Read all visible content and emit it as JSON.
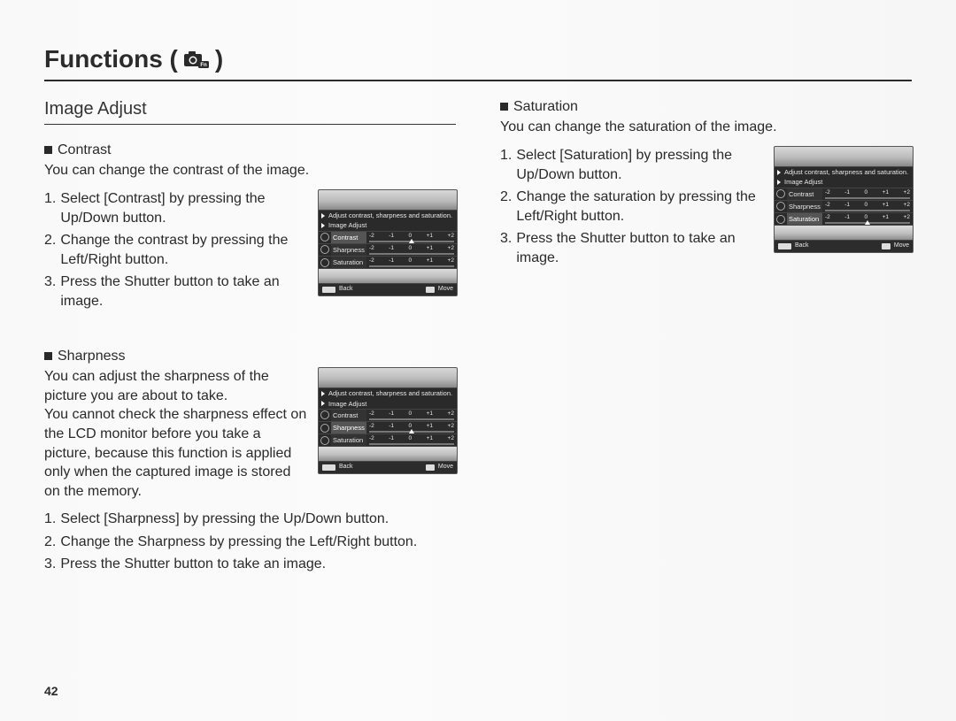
{
  "page_number": "42",
  "page_title": "Functions (",
  "page_title_after": ")",
  "section_heading": "Image Adjust",
  "lcd_common": {
    "tip_text": "Adjust contrast, sharpness and saturation.",
    "title_text": "Image Adjust",
    "scale_ticks": [
      "-2",
      "-1",
      "0",
      "+1",
      "+2"
    ],
    "rows": {
      "contrast": "Contrast",
      "sharpness": "Sharpness",
      "saturation": "Saturation"
    },
    "footer_back": "Back",
    "footer_move": "Move"
  },
  "left_col": {
    "contrast": {
      "title": "Contrast",
      "desc": "You can change the contrast of the image.",
      "steps": [
        {
          "n": "1.",
          "t": "Select [Contrast] by pressing the Up/Down button."
        },
        {
          "n": "2.",
          "t": "Change the contrast by pressing the Left/Right button."
        },
        {
          "n": "3.",
          "t": "Press the Shutter button to take an image."
        }
      ],
      "highlight_row": "contrast"
    },
    "sharpness": {
      "title": "Sharpness",
      "desc1": "You can adjust the sharpness of the picture you are about to take.",
      "desc2": "You cannot check the sharpness effect on the LCD monitor before you take a picture, because this function is applied only when the captured image is stored on the memory.",
      "steps": [
        {
          "n": "1.",
          "t": "Select [Sharpness] by pressing the Up/Down button."
        },
        {
          "n": "2.",
          "t": "Change the Sharpness by pressing the Left/Right button."
        },
        {
          "n": "3.",
          "t": "Press the Shutter button to take an image."
        }
      ],
      "highlight_row": "sharpness"
    }
  },
  "right_col": {
    "saturation": {
      "title": "Saturation",
      "desc": "You can change the saturation of the image.",
      "steps": [
        {
          "n": "1.",
          "t": "Select [Saturation] by pressing the Up/Down button."
        },
        {
          "n": "2.",
          "t": "Change the saturation by pressing the Left/Right button."
        },
        {
          "n": "3.",
          "t": "Press the Shutter button to take an image."
        }
      ],
      "highlight_row": "saturation"
    }
  }
}
